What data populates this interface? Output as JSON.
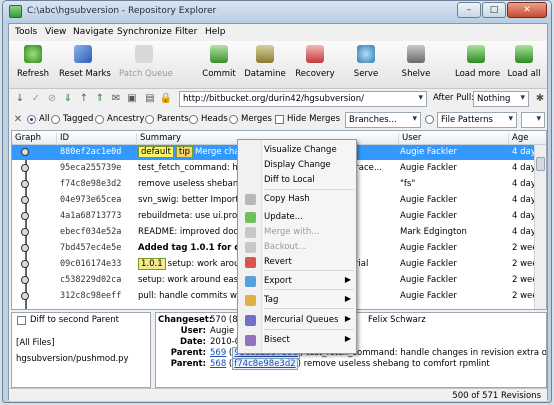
{
  "window": {
    "title": "C:\\abc\\hgsubversion - Repository Explorer"
  },
  "menu": [
    "Tools",
    "View",
    "Navigate",
    "Synchronize",
    "Filter",
    "Help"
  ],
  "toolbar": {
    "buttons": [
      {
        "label": "Refresh",
        "icon": "refresh-icon"
      },
      {
        "label": "Reset Marks",
        "icon": "reset-marks-icon"
      },
      {
        "label": "Patch Queue",
        "icon": "patch-queue-icon"
      },
      {
        "label": "Commit",
        "icon": "commit-icon"
      },
      {
        "label": "Datamine",
        "icon": "datamine-icon"
      },
      {
        "label": "Recovery",
        "icon": "recovery-icon"
      },
      {
        "label": "Serve",
        "icon": "serve-icon"
      },
      {
        "label": "Shelve",
        "icon": "shelve-icon"
      },
      {
        "label": "Load more",
        "icon": "load-more-icon"
      },
      {
        "label": "Load all",
        "icon": "load-all-icon"
      }
    ]
  },
  "sync": {
    "url": "http://bitbucket.org/durin42/hgsubversion/",
    "after_pull_label": "After Pull:",
    "after_pull_value": "Nothing"
  },
  "filters": {
    "radios": [
      "All",
      "Tagged",
      "Ancestry",
      "Parents",
      "Heads",
      "Merges"
    ],
    "hide_merges": "Hide Merges",
    "branches": "Branches...",
    "file_patterns": "File Patterns"
  },
  "columns": [
    "Graph",
    "ID",
    "Summary",
    "User",
    "Age"
  ],
  "rows": [
    {
      "id": "880ef2ac1e0d",
      "tags": [
        "default",
        "tip"
      ],
      "summary": "Merge change from Felix Schwarz",
      "user": "Augie Fackler",
      "age": "4 days a"
    },
    {
      "id": "95eca255739e",
      "tags": [],
      "summary": "test_fetch_command: hand",
      "summary_tail": "ing grace...",
      "user": "Augie Fackler",
      "age": "4 days a"
    },
    {
      "id": "f74c8e98e3d2",
      "tags": [],
      "summary": "remove useless shebang to",
      "summary_tail": "",
      "user": "\"fs\"",
      "age": "4 days a"
    },
    {
      "id": "04e973e65cea",
      "tags": [],
      "summary": "svn_swig: better ImportErro",
      "summary_tail": "",
      "user": "Augie Fackler",
      "age": "4 days a"
    },
    {
      "id": "4a1a68713773",
      "tags": [],
      "summary": "rebuildmeta: use ui.progre",
      "summary_tail": "",
      "user": "Augie Fackler",
      "age": "4 days a"
    },
    {
      "id": "ebecf034e52a",
      "tags": [],
      "summary": "README: improved docume",
      "summary_tail": "",
      "user": "Mark Edgington",
      "age": "4 days a"
    },
    {
      "id": "7bd457ec4e5e",
      "tags": [],
      "summary": "Added tag 1.0.1 for chang",
      "summary_tail": "",
      "user": "Augie Fackler",
      "age": "2 weeks",
      "bold": true
    },
    {
      "id": "09c016174e33",
      "tags": [
        "1.0.1"
      ],
      "summary": "setup: work around d",
      "summary_tail": "mercurial",
      "user": "Augie Fackler",
      "age": "2 weeks"
    },
    {
      "id": "c538229d02ca",
      "tags": [],
      "summary": "setup: work around easy_in",
      "summary_tail": "",
      "user": "Augie Fackler",
      "age": "2 weeks"
    },
    {
      "id": "312c8c98eeff",
      "tags": [],
      "summary": "pull: handle commits with",
      "summary_tail": "",
      "user": "Augie Fackler",
      "age": "2 weeks"
    }
  ],
  "context_menu": [
    {
      "label": "Visualize Change",
      "icon": "visualize-icon",
      "enabled": true
    },
    {
      "label": "Display Change",
      "icon": "display-icon",
      "enabled": true
    },
    {
      "label": "Diff to Local",
      "icon": "diff-icon",
      "enabled": true
    },
    {
      "label": "Copy Hash",
      "icon": "copy-icon",
      "enabled": true
    },
    {
      "label": "Update...",
      "icon": "update-icon",
      "enabled": true
    },
    {
      "label": "Merge with...",
      "icon": "merge-icon",
      "enabled": false
    },
    {
      "label": "Backout...",
      "icon": "backout-icon",
      "enabled": false
    },
    {
      "label": "Revert",
      "icon": "revert-icon",
      "enabled": true
    },
    {
      "label": "Export",
      "icon": "export-icon",
      "enabled": true,
      "submenu": true
    },
    {
      "label": "Tag",
      "icon": "tag-icon",
      "enabled": true,
      "submenu": true
    },
    {
      "label": "Mercurial Queues",
      "icon": "mq-icon",
      "enabled": true,
      "submenu": true
    },
    {
      "label": "Bisect",
      "icon": "bisect-icon",
      "enabled": true,
      "submenu": true
    }
  ],
  "files": {
    "diff_checkbox": "Diff to second Parent",
    "items": [
      "[All Files]",
      "hgsubversion/pushmod.py"
    ]
  },
  "details": {
    "changeset_key": "Changeset:",
    "changeset_val": "570 (880ef2ac1e0d)",
    "changeset_tail": "Felix Schwarz",
    "user_key": "User:",
    "user_val": "Augie Fac",
    "date_key": "Date:",
    "date_val": "2010-03-",
    "parent_key": "Parent:",
    "parent1_rev": "569",
    "parent1_hash": "95eca255739e",
    "parent1_text": "test_fetch_command: handle changes in revision extra ordering grac",
    "parent2_rev": "568",
    "parent2_hash": "f74c8e98e3d2",
    "parent2_text": "remove useless shebang to comfort rpmlint"
  },
  "status": "500 of 571 Revisions",
  "colors": {
    "selection": "#3399ff",
    "accent_link": "#1b4fb0"
  }
}
